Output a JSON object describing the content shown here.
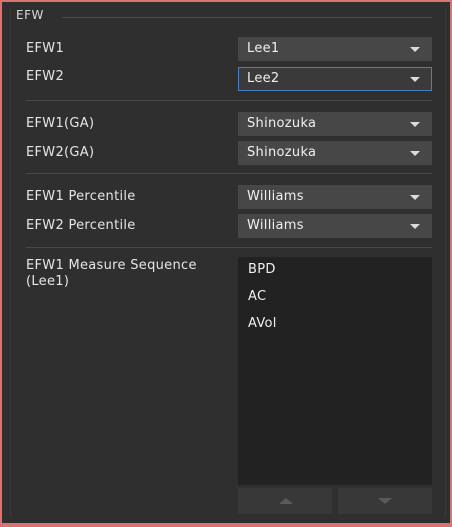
{
  "group": {
    "title": "EFW"
  },
  "rows": [
    {
      "label": "EFW1",
      "value": "Lee1"
    },
    {
      "label": "EFW2",
      "value": "Lee2"
    },
    {
      "label": "EFW1(GA)",
      "value": "Shinozuka"
    },
    {
      "label": "EFW2(GA)",
      "value": "Shinozuka"
    },
    {
      "label": "EFW1 Percentile",
      "value": "Williams"
    },
    {
      "label": "EFW2 Percentile",
      "value": "Williams"
    }
  ],
  "sequence": {
    "label_line1": "EFW1 Measure Sequence",
    "label_line2": "(Lee1)",
    "items": [
      "BPD",
      "AC",
      "AVol"
    ],
    "up_icon": "triangle-up",
    "down_icon": "triangle-down"
  },
  "colors": {
    "panel_background": "#2f2f2f",
    "dropdown_background": "#474747",
    "listbox_background": "#222222",
    "focus_border": "#4a7fc0",
    "window_border": "#d9736f"
  }
}
